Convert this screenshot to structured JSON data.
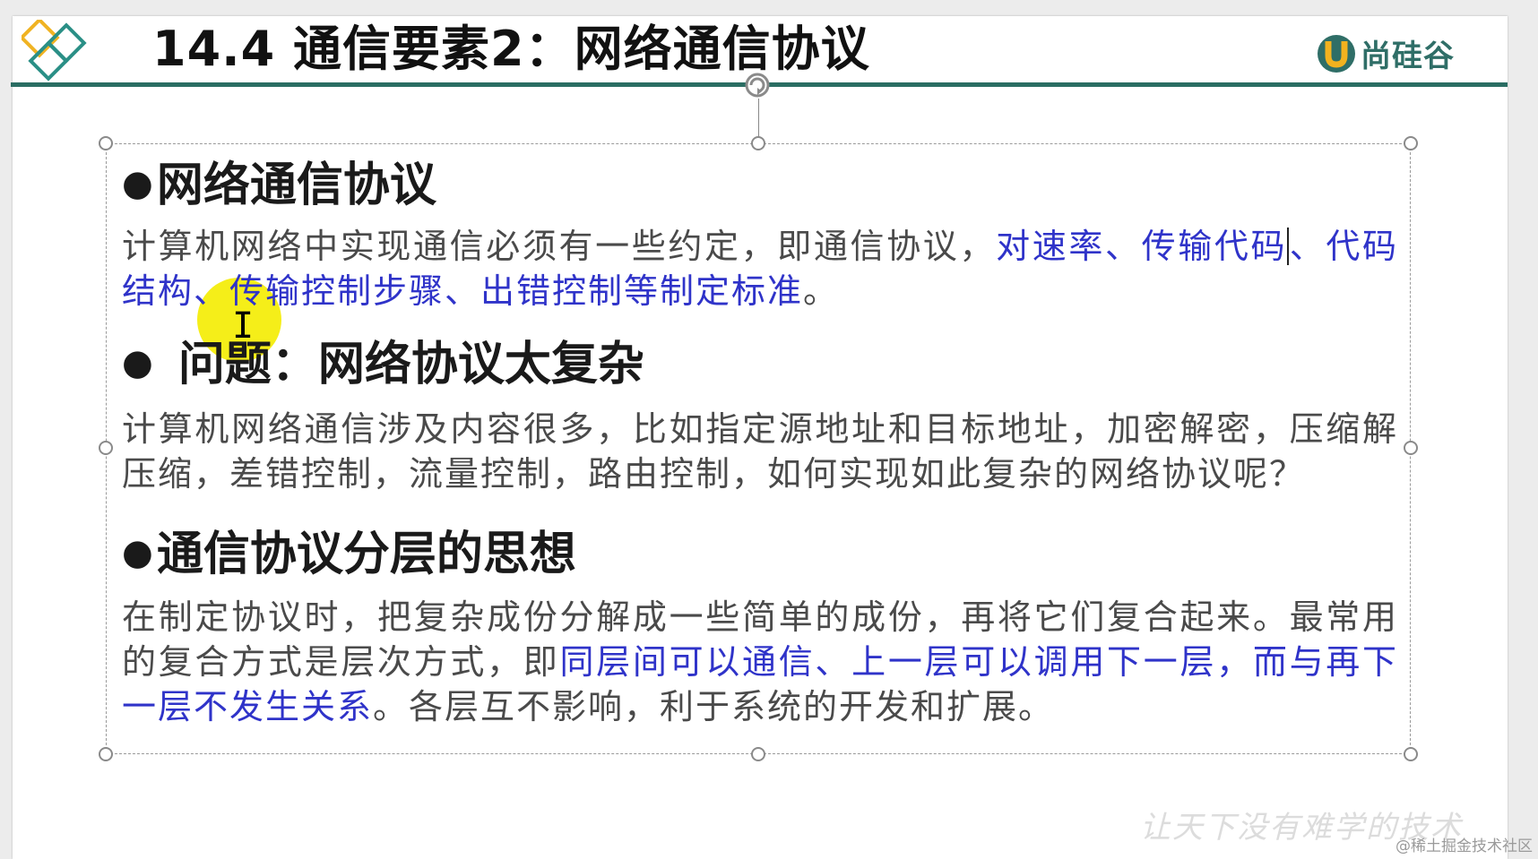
{
  "header": {
    "title": "14.4 通信要素2：网络通信协议",
    "brand_name": "尚硅谷",
    "brand_icon": "u-logo-icon",
    "accent_color": "#2a6d63"
  },
  "sections": [
    {
      "bullet": "●",
      "heading": "网络通信协议",
      "lines": [
        [
          {
            "text": "计算机网络中实现通信必须有一些约定，即通信协议，"
          },
          {
            "text": "对速率、传输代码",
            "color": "#2f33c9"
          },
          {
            "text": "、代码结构、传输控制步骤、出错控制等制定标准",
            "color": "#2f33c9"
          },
          {
            "text": "。"
          }
        ]
      ]
    },
    {
      "bullet": "●",
      "heading": "问题：网络协议太复杂",
      "lines": [
        [
          {
            "text": "计算机网络通信涉及内容很多，比如指定源地址和目标地址，加密解密，压缩解压缩，差错控制，流量控制，路由控制，如何实现如此复杂的网络协议呢？"
          }
        ]
      ]
    },
    {
      "bullet": "●",
      "heading": "通信协议分层的思想",
      "lines": [
        [
          {
            "text": "在制定协议时，把复杂成份分解成一些简单的成份，再将它们复合起来。最常用的复合方式是层次方式，即"
          },
          {
            "text": "同层间可以通信、上一层可以调用下一层，而与再下一层不发生关系",
            "color": "#2f33c9"
          },
          {
            "text": "。各层互不影响，利于系统的开发和扩展。"
          }
        ]
      ]
    }
  ],
  "watermark": "让天下没有难学的技术",
  "credit": "@稀土掘金技术社区",
  "icons": [
    "diamond-logo-icon",
    "rotate-handle-icon",
    "i-beam-cursor-icon"
  ],
  "highlight_color": "#f4ec00"
}
